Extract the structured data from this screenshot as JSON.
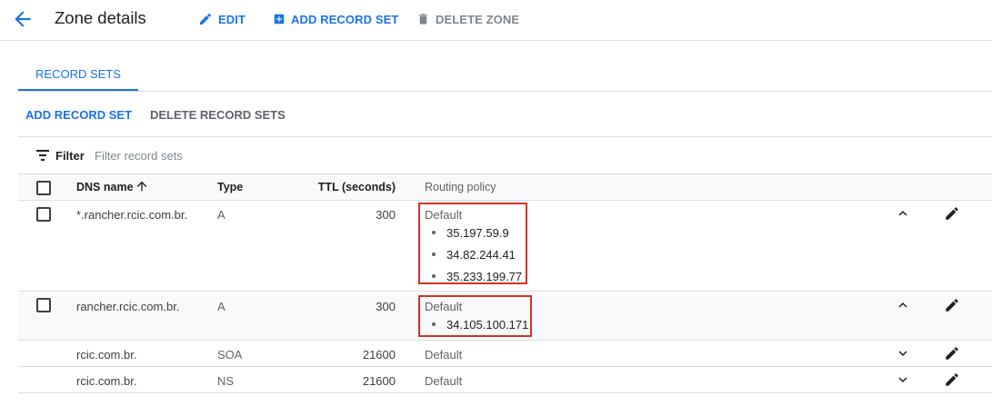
{
  "header": {
    "title": "Zone details",
    "edit_label": "EDIT",
    "add_record_set_label": "ADD RECORD SET",
    "delete_zone_label": "DELETE ZONE"
  },
  "tabs": [
    {
      "label": "RECORD SETS",
      "active": true
    }
  ],
  "actions": {
    "add_record_set": "ADD RECORD SET",
    "delete_record_sets": "DELETE RECORD SETS"
  },
  "filter": {
    "label": "Filter",
    "placeholder": "Filter record sets"
  },
  "table": {
    "columns": {
      "dns_name": "DNS name",
      "type": "Type",
      "ttl": "TTL (seconds)",
      "routing_policy": "Routing policy"
    },
    "sort": {
      "column": "dns_name",
      "direction": "ascending"
    },
    "rows": [
      {
        "dns_name": "*.rancher.rcic.com.br.",
        "type": "A",
        "ttl": "300",
        "policy": "Default",
        "ips": [
          "35.197.59.9",
          "34.82.244.41",
          "35.233.199.77"
        ],
        "expanded": true,
        "selectable": true
      },
      {
        "dns_name": "rancher.rcic.com.br.",
        "type": "A",
        "ttl": "300",
        "policy": "Default",
        "ips": [
          "34.105.100.171"
        ],
        "expanded": true,
        "selectable": true
      },
      {
        "dns_name": "rcic.com.br.",
        "type": "SOA",
        "ttl": "21600",
        "policy": "Default",
        "ips": [],
        "expanded": false,
        "selectable": false
      },
      {
        "dns_name": "rcic.com.br.",
        "type": "NS",
        "ttl": "21600",
        "policy": "Default",
        "ips": [],
        "expanded": false,
        "selectable": false
      }
    ]
  },
  "colors": {
    "accent": "#1a73e8",
    "highlight_box": "#d93025",
    "text": "#202124",
    "muted": "#5f6368",
    "divider": "#dadce0"
  },
  "icons": {
    "back": "arrow-back-icon",
    "edit": "pencil-icon",
    "add": "add-box-icon",
    "delete": "trash-icon",
    "filter": "filter-list-icon",
    "sort": "arrow-upward-icon",
    "expand": "chevron-down-icon",
    "collapse": "chevron-up-icon"
  }
}
